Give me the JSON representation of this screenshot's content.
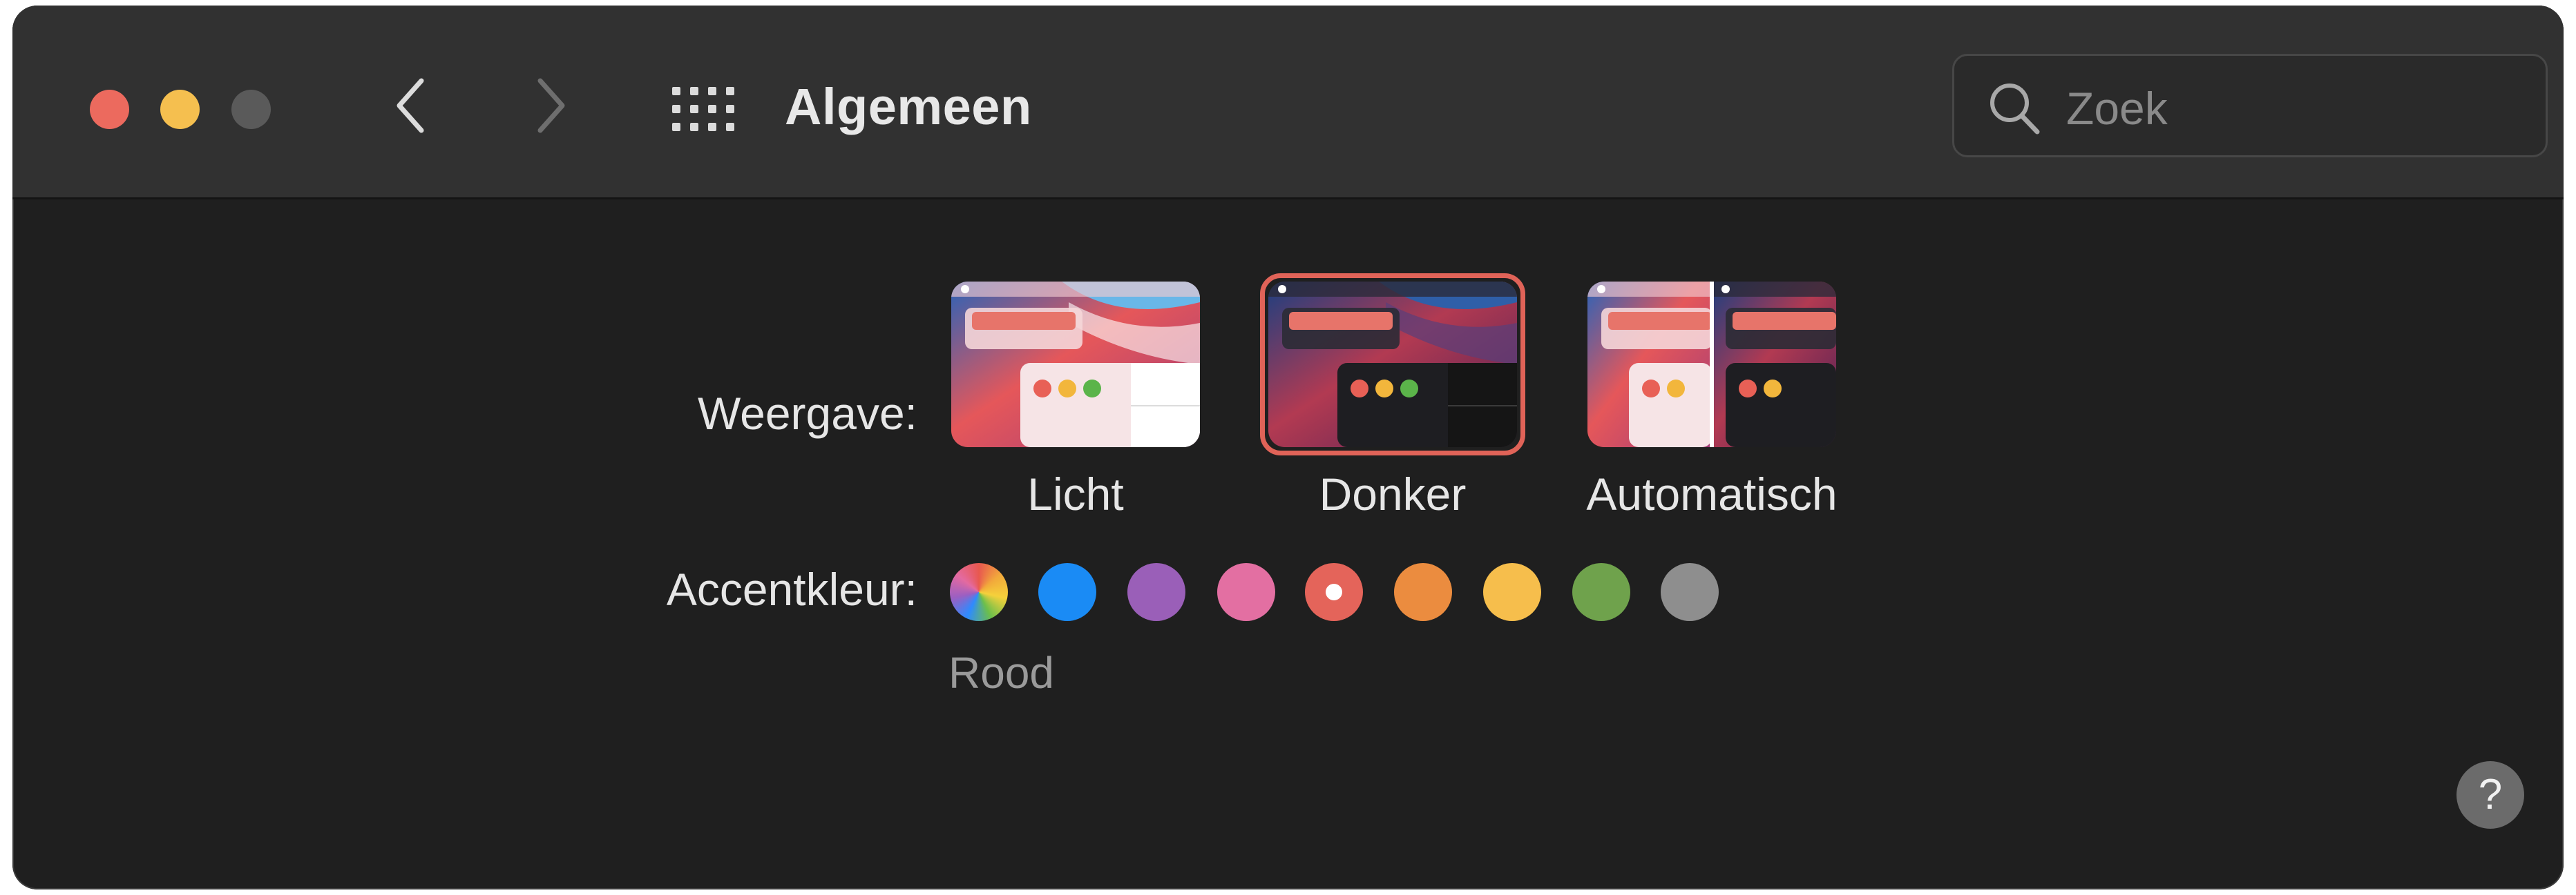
{
  "window": {
    "title": "Algemeen",
    "traffic_lights": [
      "close",
      "minimize",
      "maximize-disabled"
    ],
    "nav_icons": [
      "chevron-left-icon",
      "chevron-right-icon",
      "grid-icon"
    ]
  },
  "search": {
    "placeholder": "Zoek",
    "icon": "search-icon"
  },
  "appearance": {
    "label": "Weergave:",
    "options": [
      {
        "label": "Licht",
        "selected": false
      },
      {
        "label": "Donker",
        "selected": true
      },
      {
        "label": "Automatisch",
        "selected": false
      }
    ]
  },
  "accent": {
    "label": "Accentkleur:",
    "selected_name": "Rood",
    "colors": [
      {
        "name": "multicolor",
        "color": "multicolor"
      },
      {
        "name": "blue",
        "color": "#1a8bf5"
      },
      {
        "name": "purple",
        "color": "#9a5fb8"
      },
      {
        "name": "pink",
        "color": "#e36fa2"
      },
      {
        "name": "red",
        "color": "#e4645a",
        "selected": true
      },
      {
        "name": "orange",
        "color": "#eb8c3f"
      },
      {
        "name": "yellow",
        "color": "#f6be4c"
      },
      {
        "name": "green",
        "color": "#6fa24c"
      },
      {
        "name": "graphite",
        "color": "#8e8e8e"
      }
    ]
  },
  "help": {
    "label": "?"
  }
}
